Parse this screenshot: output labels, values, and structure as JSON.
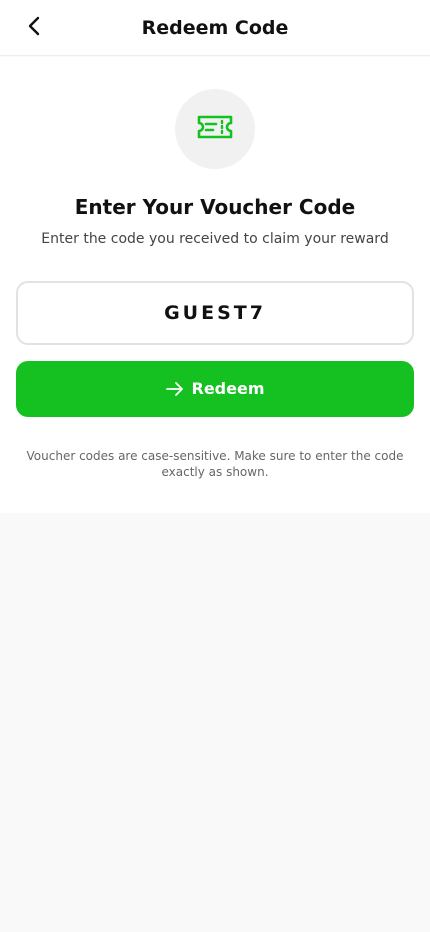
{
  "header": {
    "title": "Redeem Code",
    "back_icon": "chevron-left-icon"
  },
  "main": {
    "icon": "ticket-icon",
    "heading": "Enter Your Voucher Code",
    "subheading": "Enter the code you received to claim your reward",
    "code_input": {
      "value": "GUEST7",
      "placeholder": ""
    },
    "redeem_button": {
      "label": "Redeem",
      "icon": "arrow-right-icon"
    },
    "note": "Voucher codes are case-sensitive. Make sure to enter the code exactly as shown."
  },
  "colors": {
    "accent": "#15c120",
    "background": "#f9f9f9",
    "surface": "#ffffff"
  }
}
